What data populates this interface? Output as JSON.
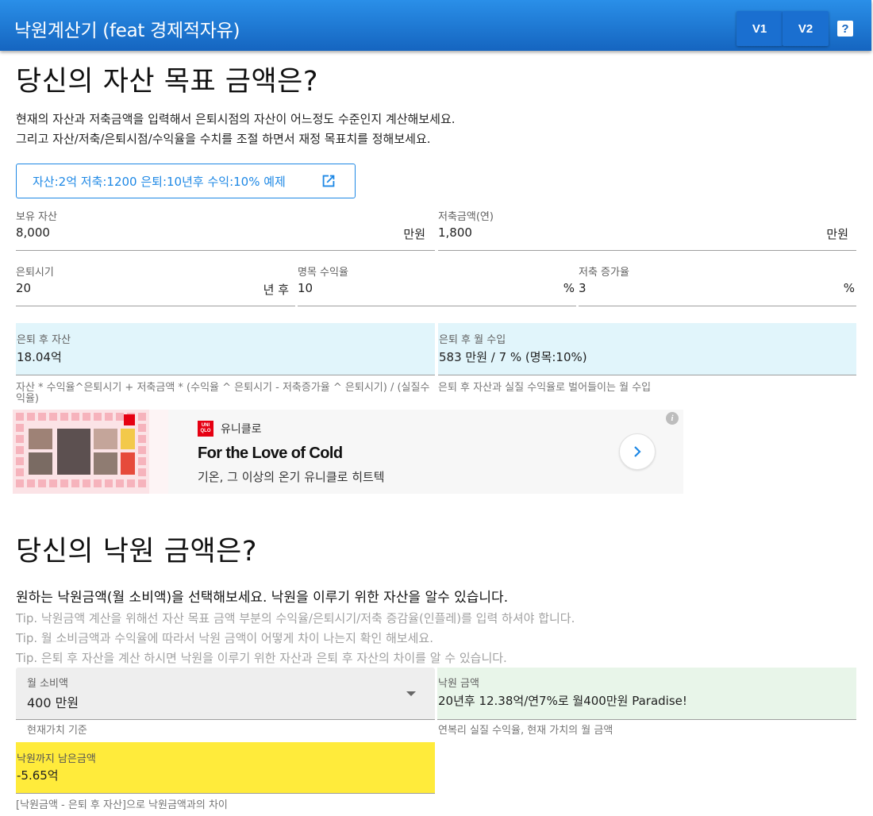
{
  "appbar": {
    "title": "낙원계산기 (feat 경제적자유)",
    "v1_label": "V1",
    "v2_label": "V2",
    "help_label": "?"
  },
  "section1": {
    "title": "당신의 자산 목표 금액은?",
    "desc_line1": "현재의 자산과 저축금액을 입력해서 은퇴시점의 자산이 어느정도 수준인지 계산해보세요.",
    "desc_line2": "그리고 자산/저축/은퇴시점/수익율을 수치를 조절 하면서 재정 목표치를 정해보세요.",
    "example_button": "자산:2억 저축:1200 은퇴:10년후 수익:10% 예제",
    "assets": {
      "label": "보유 자산",
      "value": "8,000",
      "unit": "만원"
    },
    "savings": {
      "label": "저축금액(연)",
      "value": "1,800",
      "unit": "만원"
    },
    "retire": {
      "label": "은퇴시기",
      "value": "20",
      "unit": "년 후"
    },
    "nominal_return": {
      "label": "명목 수익율",
      "value": "10",
      "unit": "%"
    },
    "savings_growth": {
      "label": "저축 증가율",
      "value": "3",
      "unit": "%"
    },
    "retire_assets": {
      "label": "은퇴 후 자산",
      "value": "18.04억",
      "hint": "자산 * 수익율^은퇴시기 + 저축금액 * (수익율 ^ 은퇴시기 - 저축증가율 ^ 은퇴시기) / (실질수익율)"
    },
    "retire_income": {
      "label": "은퇴 후 월 수입",
      "value": "583 만원 / 7 % (명목:10%)",
      "hint": "은퇴 후 자산과 실질 수익율로 벌어들이는 월 수입"
    }
  },
  "ad": {
    "logo_text": "UNI QLO",
    "brand": "유니클로",
    "headline": "For the Love of Cold",
    "sub": "기온, 그 이상의 온기 유니클로 히트텍",
    "info": "i"
  },
  "section2": {
    "title": "당신의 낙원 금액은?",
    "intro": "원하는 낙원금액(월 소비액)을 선택해보세요. 낙원을 이루기 위한 자산을 알수 있습니다.",
    "tips": [
      "Tip. 낙원금액 계산을 위해선 자산 목표 금액 부분의 수익율/은퇴시기/저축 증감율(인플레)를 입력 하셔야 합니다.",
      "Tip. 월 소비금액과 수익율에 따라서 낙원 금액이 어떻게 차이 나는지 확인 해보세요.",
      "Tip. 은퇴 후 자산을 계산 하시면 낙원을 이루기 위한 자산과 은퇴 후 자산의 차이를 알 수 있습니다."
    ],
    "monthly_spend": {
      "label": "월 소비액",
      "value": "400 만원",
      "hint": "현재가치 기준"
    },
    "paradise": {
      "label": "낙원 금액",
      "value": "20년후 12.38억/연7%로 월400만원 Paradise!",
      "hint": "연복리 실질 수익율, 현재 가치의 월 금액"
    },
    "remaining": {
      "label": "낙원까지 남은금액",
      "value": "-5.65억",
      "hint": "[낙원금액 - 은퇴 후 자산]으로 낙원금액과의 차이"
    }
  },
  "colors": {
    "appbar": "#1565c0",
    "accent": "#1e88e5",
    "result_bg": "#e1f5fb",
    "paradise_bg": "#e8f5e9",
    "remain_bg": "#ffeb3b"
  }
}
